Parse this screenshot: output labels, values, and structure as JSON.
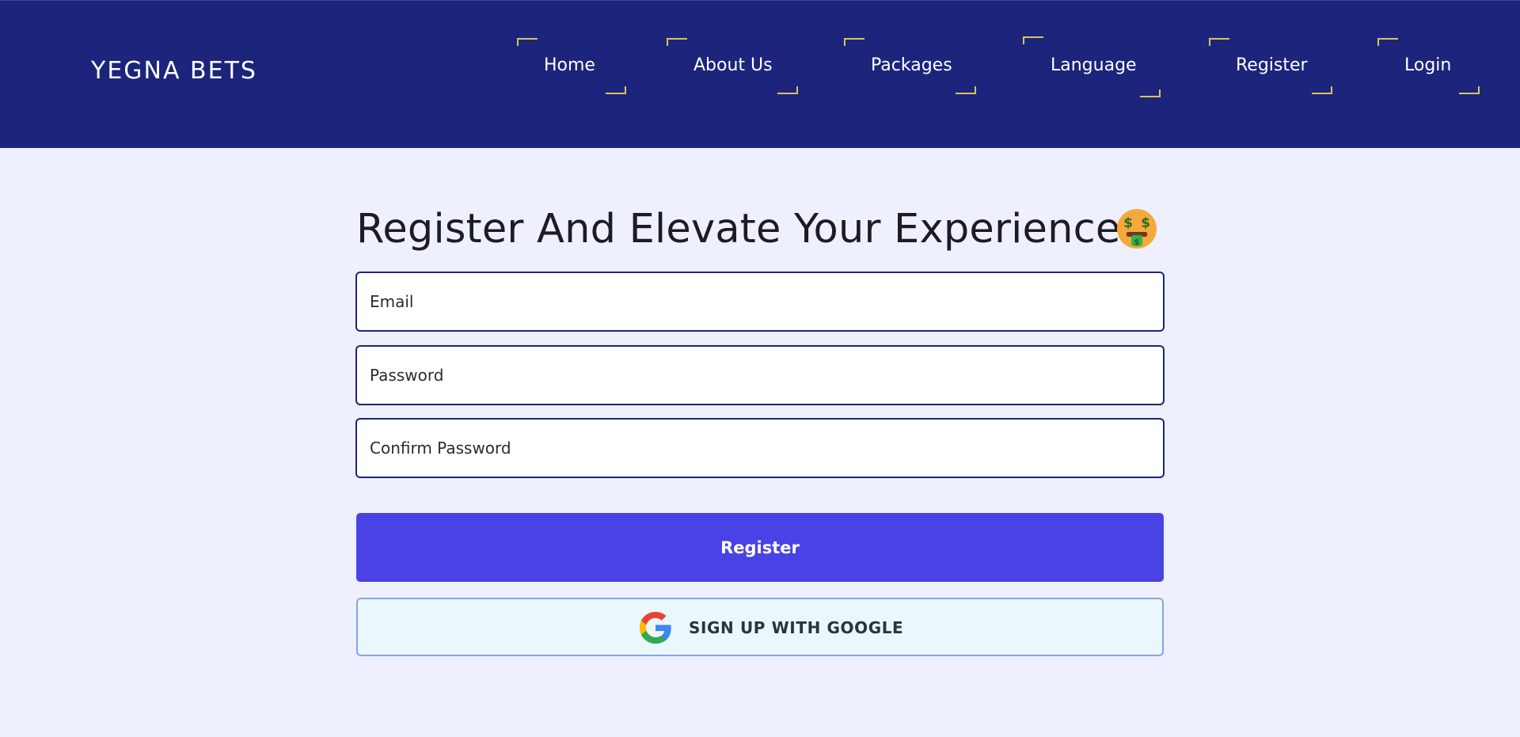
{
  "header": {
    "brand": "YEGNA BETS",
    "nav": [
      {
        "label": "Home"
      },
      {
        "label": "About Us"
      },
      {
        "label": "Packages"
      },
      {
        "label": "Language"
      },
      {
        "label": "Register"
      },
      {
        "label": "Login"
      }
    ],
    "background": "#1c257b",
    "accent": "#d8c35f"
  },
  "form": {
    "title": "Register And Elevate Your Experience!",
    "title_emoji": "money-mouth-face-icon",
    "email": {
      "placeholder": "Email",
      "value": ""
    },
    "password": {
      "placeholder": "Password",
      "value": ""
    },
    "confirm_password": {
      "placeholder": "Confirm Password",
      "value": ""
    },
    "register_label": "Register",
    "google_label": "SIGN UP WITH GOOGLE",
    "button_color": "#4942e4"
  }
}
